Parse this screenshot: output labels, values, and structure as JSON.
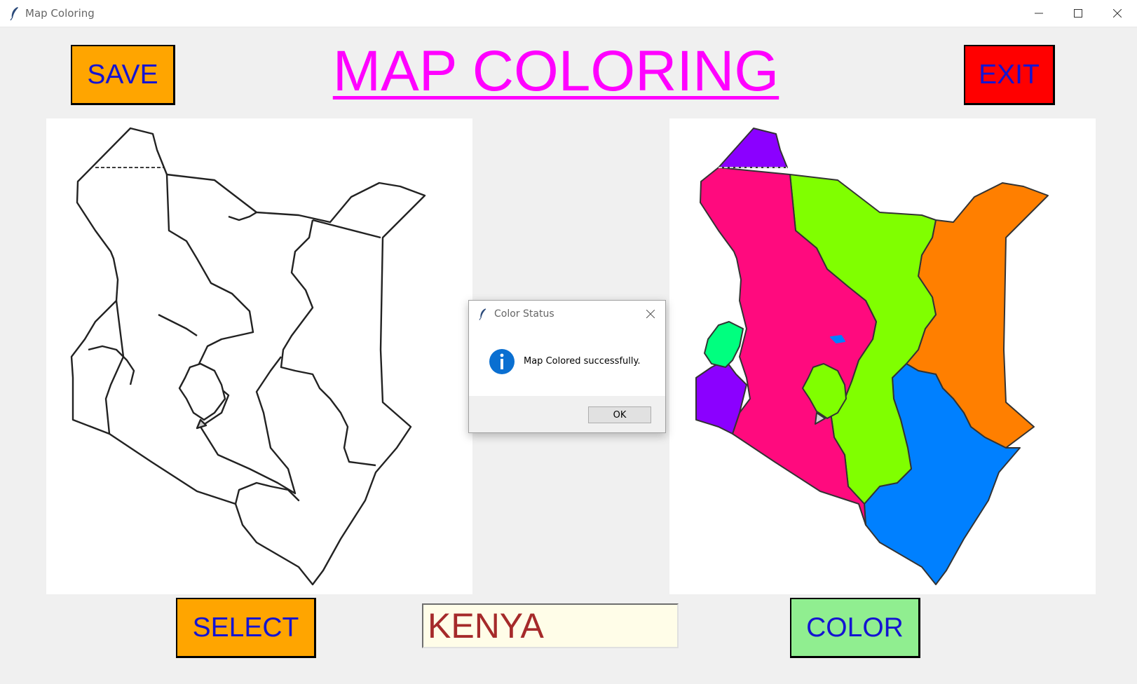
{
  "window": {
    "title": "Map Coloring"
  },
  "header": {
    "heading": "MAP COLORING",
    "save_label": "SAVE",
    "exit_label": "EXIT"
  },
  "footer": {
    "select_label": "SELECT",
    "country_value": "KENYA",
    "color_label": "COLOR"
  },
  "dialog": {
    "title": "Color Status",
    "message": "Map Colored successfully.",
    "ok_label": "OK"
  },
  "colors": {
    "save_bg": "#ffa500",
    "exit_bg": "#ff0000",
    "color_bg": "#90ee90",
    "button_text": "#1414d2",
    "heading": "#ff00ff",
    "input_text": "#a52a2a",
    "region_purple": "#8b00ff",
    "region_pink": "#ff0a7e",
    "region_green": "#80ff00",
    "region_orange": "#ff7f00",
    "region_blue": "#0080ff",
    "region_mint": "#00ff7f"
  },
  "icons": {
    "app": "feather-icon",
    "dialog_info": "info-icon"
  }
}
